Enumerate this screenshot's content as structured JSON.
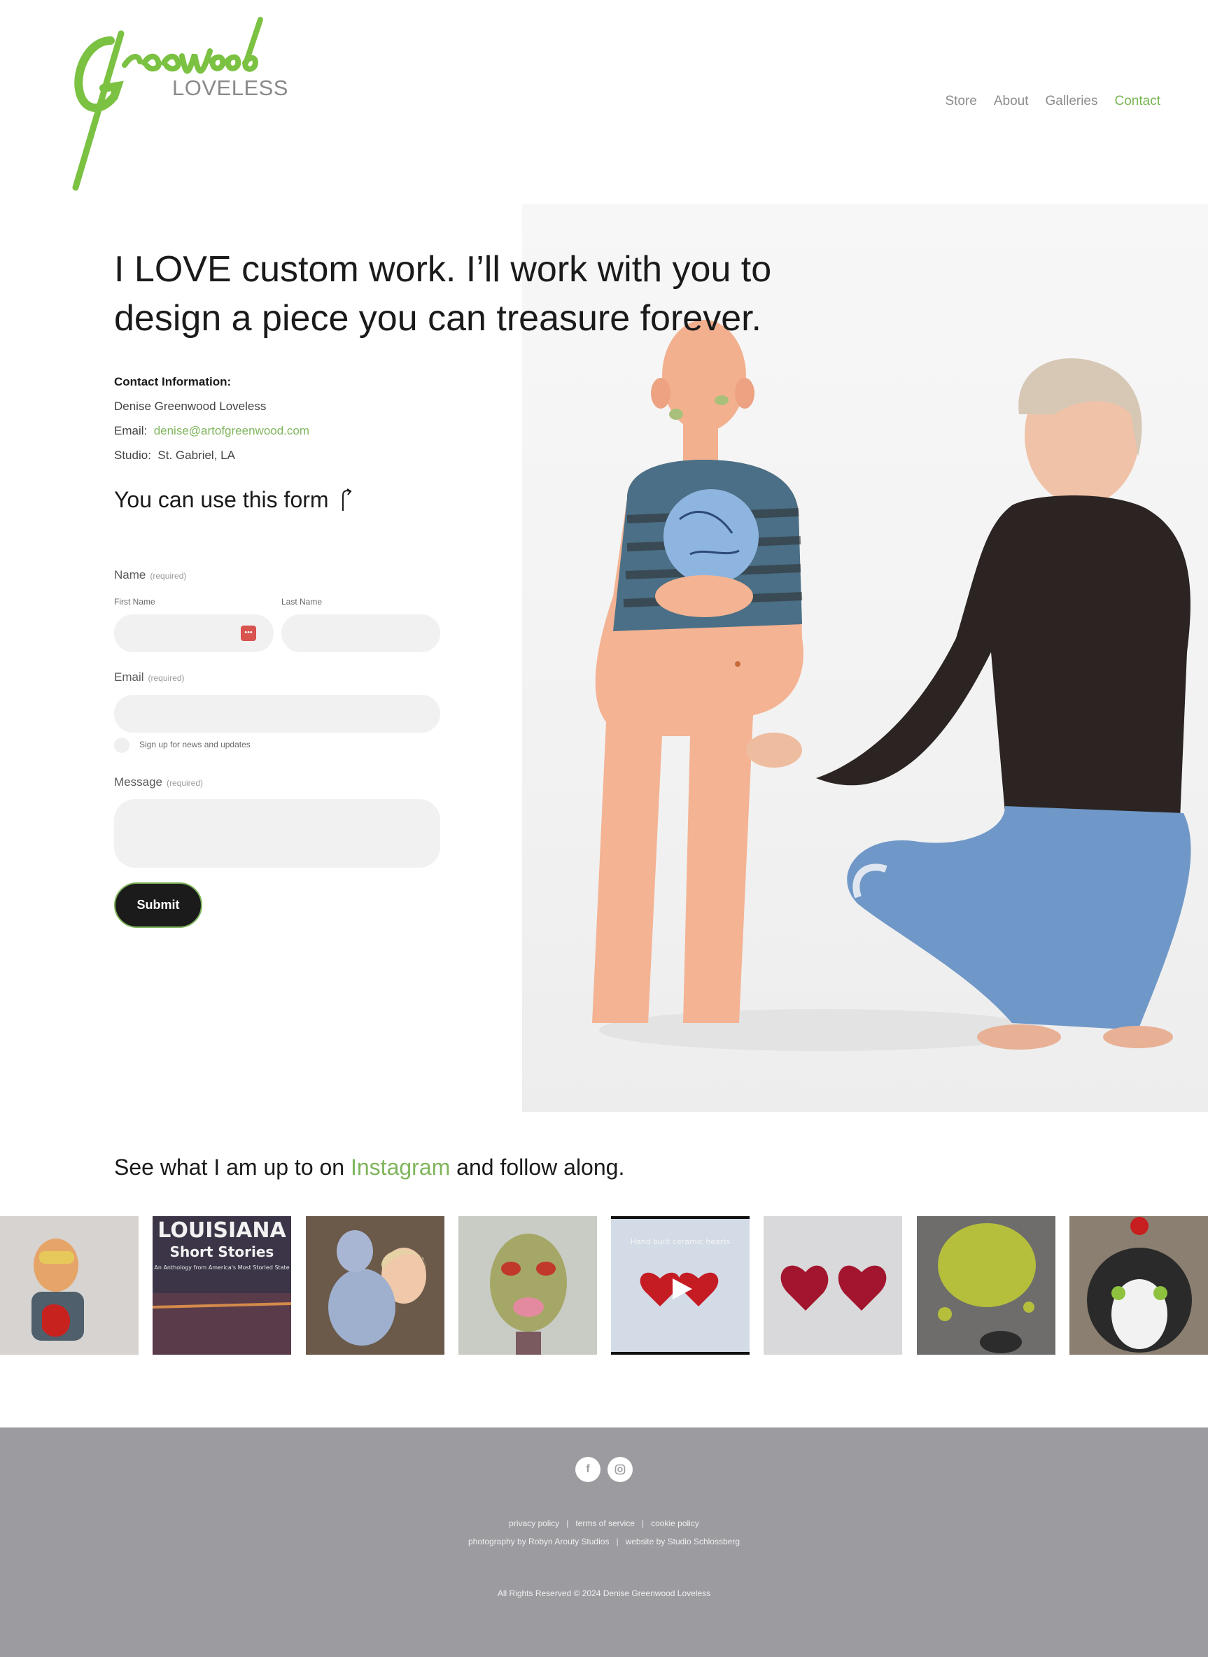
{
  "header": {
    "logo_script": "Greenwood",
    "logo_sub": "LOVELESS",
    "nav": [
      "Store",
      "About",
      "Galleries",
      "Contact"
    ],
    "active_nav": "Contact"
  },
  "hero": {
    "headline": "I LOVE custom work. I’ll work with you to design a piece you can treasure forever."
  },
  "contact": {
    "title": "Contact Information:",
    "name": "Denise Greenwood Loveless",
    "email_label": "Email:",
    "email_value": "denise@artofgreenwood.com",
    "studio_label": "Studio:",
    "studio_value": "St. Gabriel, LA"
  },
  "form": {
    "title": "You can use this form",
    "name_label": "Name",
    "required": "(required)",
    "first_name": "First Name",
    "last_name": "Last Name",
    "email_label": "Email",
    "signup_label": "Sign up for news and updates",
    "message_label": "Message",
    "submit": "Submit",
    "pwd_icon": "•••"
  },
  "instagram": {
    "prefix": "See what I am up to on ",
    "link": "Instagram",
    "suffix": " and follow along.",
    "tile2_title": "LOUISIANA",
    "tile2_sub": "Short Stories",
    "tile2_caption": "An Anthology from America's Most Storied State",
    "tile5_caption": "Hand built ceramic hearts"
  },
  "footer": {
    "facebook": "f",
    "links1": [
      "privacy policy",
      "terms of service",
      "cookie policy"
    ],
    "links2": [
      "photography by Robyn Arouty Studios",
      "website by Studio Schlossberg"
    ],
    "copyright": "All Rights Reserved © 2024 Denise Greenwood Loveless",
    "bg_color": "#9b9ba0"
  },
  "colors": {
    "accent": "#76b551",
    "button": "#1b1b1b"
  }
}
